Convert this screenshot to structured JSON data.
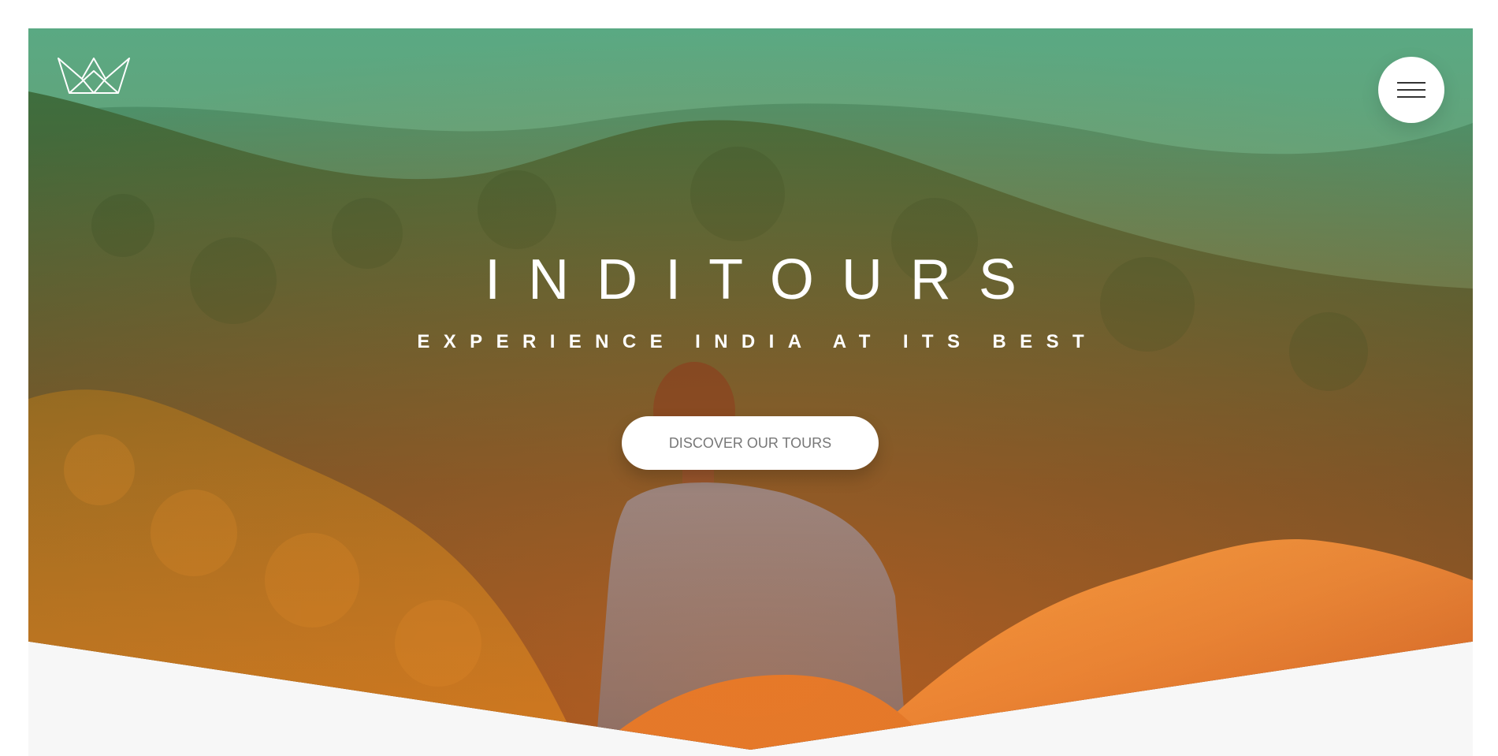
{
  "header": {
    "logo_icon": "crown-icon",
    "menu_icon": "hamburger-menu-icon"
  },
  "hero": {
    "title": "INDITOURS",
    "subtitle": "EXPERIENCE INDIA AT ITS BEST",
    "cta_label": "DISCOVER OUR TOURS"
  },
  "colors": {
    "gradient_top": "#5fb58f",
    "gradient_bottom": "#d07a2f",
    "cta_text": "#777777",
    "page_bg": "#f7f7f7"
  }
}
